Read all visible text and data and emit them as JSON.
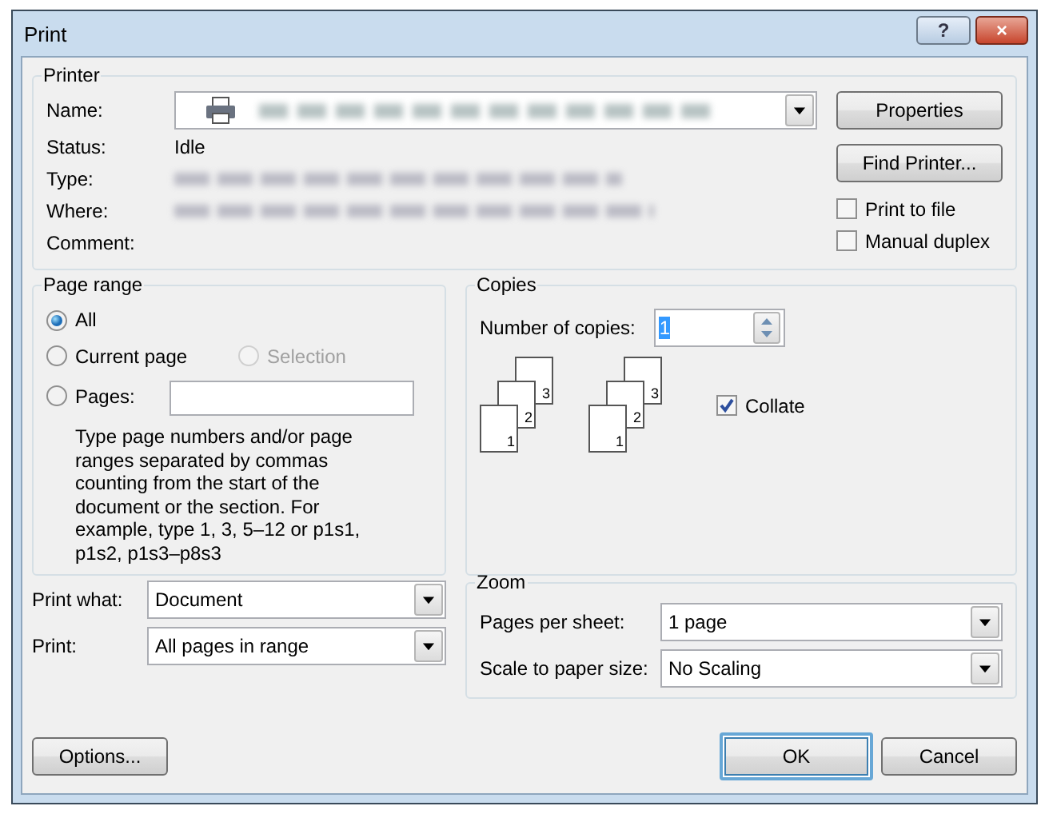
{
  "window": {
    "title": "Print",
    "help_button": "?",
    "close_button": "×"
  },
  "printer": {
    "legend": "Printer",
    "name_label": "Name:",
    "status_label": "Status:",
    "status": "Idle",
    "type_label": "Type:",
    "where_label": "Where:",
    "comment_label": "Comment:",
    "properties_button": "Properties",
    "find_button": "Find Printer...",
    "options": [
      {
        "label": "Print to file",
        "checked": false
      },
      {
        "label": "Manual duplex",
        "checked": false
      }
    ]
  },
  "page_range": {
    "legend": "Page range",
    "options": [
      {
        "label": "All",
        "selected": true,
        "disabled": false
      },
      {
        "label": "Current page",
        "selected": false,
        "disabled": false
      },
      {
        "label": "Selection",
        "selected": false,
        "disabled": true
      },
      {
        "label": "Pages:",
        "selected": false,
        "disabled": false
      }
    ],
    "hint": "Type page numbers and/or page ranges separated by commas counting from the start of the document or the section. For example, type 1, 3, 5–12 or p1s1, p1s2, p1s3–p8s3"
  },
  "copies": {
    "legend": "Copies",
    "count_label": "Number of copies:",
    "count": "1",
    "count_highlighted": true,
    "stacks": [
      [
        "3",
        "2",
        "1"
      ],
      [
        "3",
        "2",
        "1"
      ]
    ],
    "collate": {
      "label": "Collate",
      "checked": true
    }
  },
  "print_what": {
    "label": "Print what:",
    "value": "Document"
  },
  "print": {
    "label": "Print:",
    "value": "All pages in range"
  },
  "zoom": {
    "legend": "Zoom",
    "rows": [
      {
        "label": "Pages per sheet:",
        "value": "1 page"
      },
      {
        "label": "Scale to paper size:",
        "value": "No Scaling"
      }
    ]
  },
  "buttons": [
    {
      "label": "Options...",
      "default": false
    },
    {
      "label": "OK",
      "default": true
    },
    {
      "label": "Cancel",
      "default": false
    }
  ]
}
